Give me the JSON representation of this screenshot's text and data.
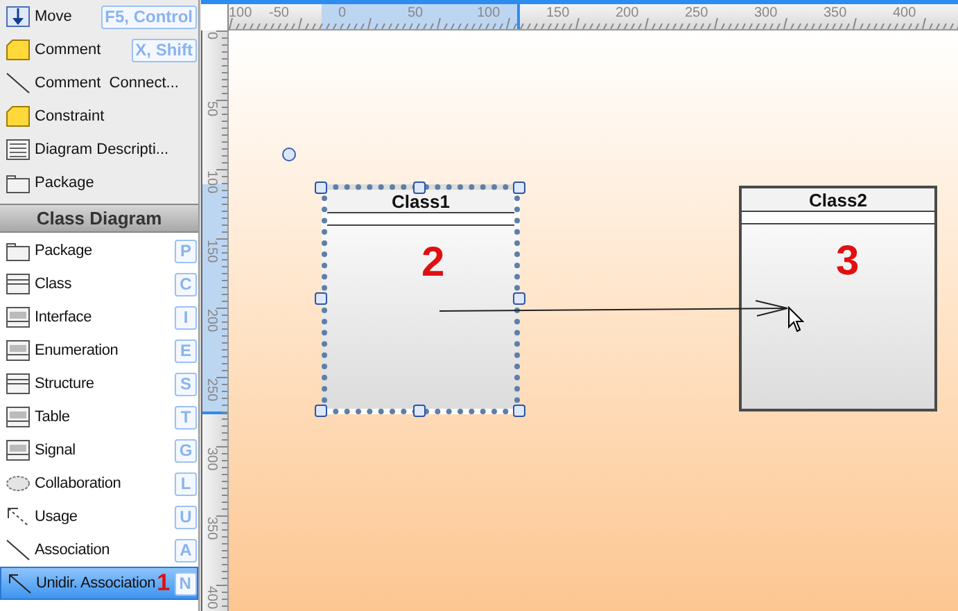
{
  "palette": {
    "items": [
      {
        "label": "Move",
        "shortcut": "F5, Control",
        "kind": "move"
      },
      {
        "label": "Comment",
        "shortcut": "X, Shift",
        "kind": "note"
      },
      {
        "label": "Comment  Connect...",
        "kind": "line"
      },
      {
        "label": "Constraint",
        "kind": "note"
      },
      {
        "label": "Diagram Descripti...",
        "kind": "lines"
      },
      {
        "label": "Package",
        "kind": "package"
      }
    ],
    "section": {
      "title": "Class Diagram",
      "items": [
        {
          "label": "Package",
          "shortcut": "P",
          "kind": "package",
          "selected": false
        },
        {
          "label": "Class",
          "shortcut": "C",
          "kind": "class",
          "selected": false
        },
        {
          "label": "Interface",
          "shortcut": "I",
          "kind": "stereo",
          "selected": false
        },
        {
          "label": "Enumeration",
          "shortcut": "E",
          "kind": "stereo",
          "selected": false
        },
        {
          "label": "Structure",
          "shortcut": "S",
          "kind": "class",
          "selected": false
        },
        {
          "label": "Table",
          "shortcut": "T",
          "kind": "stereo",
          "selected": false
        },
        {
          "label": "Signal",
          "shortcut": "G",
          "kind": "stereo",
          "selected": false
        },
        {
          "label": "Collaboration",
          "shortcut": "L",
          "kind": "ellipse",
          "selected": false
        },
        {
          "label": "Usage",
          "shortcut": "U",
          "kind": "dashed",
          "selected": false
        },
        {
          "label": "Association",
          "shortcut": "A",
          "kind": "line",
          "selected": false
        },
        {
          "label": "Unidir. Association",
          "shortcut": "N",
          "kind": "arrow",
          "selected": true,
          "annotation": "1"
        }
      ]
    }
  },
  "rulers": {
    "horizontal": [
      "100",
      "-50",
      "0",
      "50",
      "100",
      "150",
      "200",
      "250",
      "300",
      "350",
      "400"
    ],
    "vertical": [
      "0",
      "50",
      "100",
      "150",
      "200",
      "250",
      "300",
      "350",
      "400"
    ]
  },
  "diagram": {
    "classes": [
      {
        "name": "Class1",
        "selected": true,
        "annotation": "2"
      },
      {
        "name": "Class2",
        "selected": false,
        "annotation": "3"
      }
    ]
  }
}
